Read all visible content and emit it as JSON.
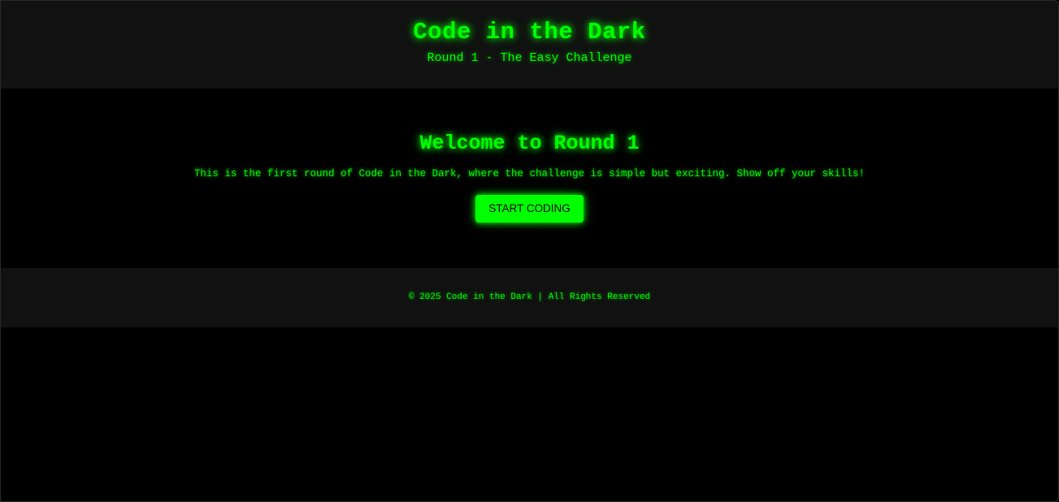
{
  "header": {
    "title": "Code in the Dark",
    "subtitle": "Round 1 - The Easy Challenge"
  },
  "main": {
    "heading": "Welcome to Round 1",
    "description": "This is the first round of Code in the Dark, where the challenge is simple but exciting. Show off your skills!",
    "start_button_label": "START CODING"
  },
  "footer": {
    "copyright": "© 2025 Code in the Dark | All Rights Reserved"
  },
  "colors": {
    "accent": "#00ff00",
    "background": "#000000",
    "panel": "#111111"
  }
}
